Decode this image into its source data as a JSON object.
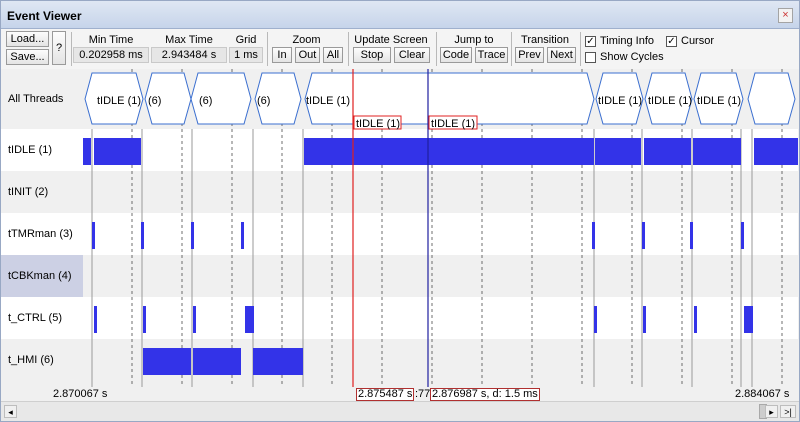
{
  "window": {
    "title": "Event Viewer",
    "close_glyph": "×"
  },
  "toolbar": {
    "load_label": "Load...",
    "save_label": "Save...",
    "help_label": "?",
    "min_time_label": "Min Time",
    "min_time_value": "0.202958 ms",
    "max_time_label": "Max Time",
    "max_time_value": "2.943484 s",
    "grid_label": "Grid",
    "grid_value": "1 ms",
    "zoom_label": "Zoom",
    "zoom_in": "In",
    "zoom_out": "Out",
    "zoom_all": "All",
    "update_label": "Update Screen",
    "stop_label": "Stop",
    "clear_label": "Clear",
    "jump_label": "Jump to",
    "code_label": "Code",
    "trace_label": "Trace",
    "transition_label": "Transition",
    "prev_label": "Prev",
    "next_label": "Next",
    "timing_info_label": "Timing Info",
    "timing_info_checked": true,
    "cursor_label": "Cursor",
    "cursor_checked": true,
    "show_cycles_label": "Show Cycles",
    "show_cycles_checked": false
  },
  "threads": [
    {
      "name": "All Threads"
    },
    {
      "name": "tIDLE (1)"
    },
    {
      "name": "tINIT (2)"
    },
    {
      "name": "tTMRman (3)"
    },
    {
      "name": "tCBKman (4)"
    },
    {
      "name": "t_CTRL (5)"
    },
    {
      "name": "t_HMI (6)"
    }
  ],
  "all_threads_labels": [
    "tIDLE (1)",
    "(6)",
    "(6)",
    "(6)",
    "tIDLE (1)",
    "tIDLE (1)",
    "tIDLE (1)",
    "tIDLE (1)"
  ],
  "cursor_labels": {
    "red": "tIDLE (1)",
    "blue": "tIDLE (1)"
  },
  "footer": {
    "start_time": "2.870067 s",
    "red_cursor_time": "2.875487 s",
    "partial_text": ":77",
    "blue_cursor_time": "2.876987 s,  d: 1.5 ms",
    "end_time": "2.884067 s"
  },
  "colors": {
    "bar": "#3333e8",
    "red_cursor": "#e02020",
    "blue_cursor": "#2020a0",
    "row_light": "#ffffff",
    "row_dark": "#f0f0f0"
  },
  "scrollbar": {
    "left_arrow": "◂",
    "right_arrow": "▸",
    "end_glyph": ">|"
  }
}
